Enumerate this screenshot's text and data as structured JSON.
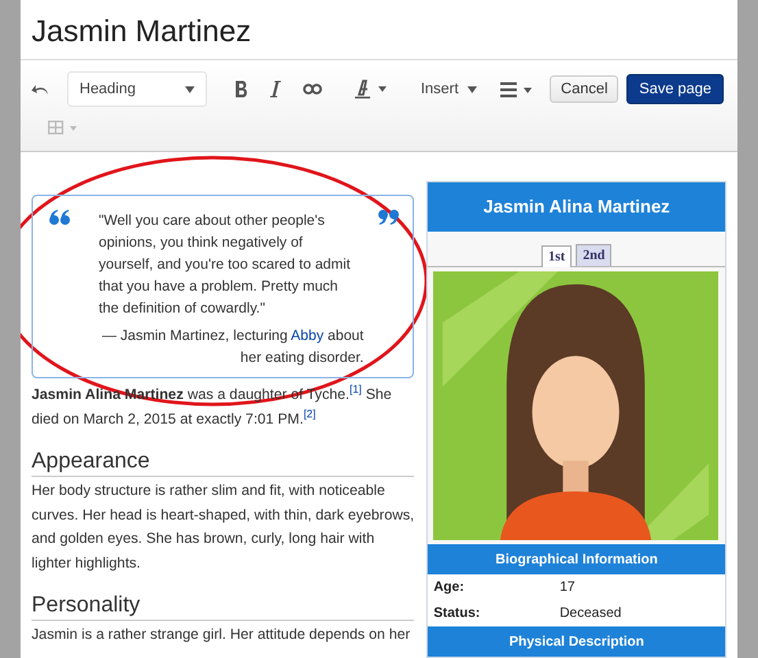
{
  "page": {
    "title": "Jasmin Martinez"
  },
  "toolbar": {
    "format_dropdown": "Heading",
    "insert_menu": "Insert",
    "cancel": "Cancel",
    "save": "Save page"
  },
  "quote": {
    "text": "\"Well you care about other people's opinions, you think negatively of yourself, and you're too scared to admit that you have a problem. Pretty much the definition of cowardly.\"",
    "attribution_start": "— Jasmin Martinez, lecturing",
    "link": "Abby",
    "attribution_end": "about her eating disorder."
  },
  "intro": "**Jasmin Alina Martinez** was a daughter of Tyche.$^{[1]}$ She died on March 2, 2015 at exactly 7:01 PM.$^{[2]}$",
  "sections": [
    {
      "heading": "Appearance",
      "text": "Her body structure is rather slim and fit, with noticeable curves. Her head is heart-shaped, with thin, dark eyebrows, and golden eyes. She has brown, curly, long hair with lighter highlights."
    },
    {
      "heading": "Personality",
      "text": "Jasmin is a rather strange girl. Her attitude depends on her"
    }
  ],
  "infobox": {
    "title": "Jasmin Alina Martinez",
    "tabs": [
      {
        "label": "1st",
        "selected": true
      },
      {
        "label": "2nd",
        "selected": false
      }
    ],
    "sections": [
      {
        "heading": "Biographical Information",
        "rows": [
          {
            "label": "Age:",
            "value": "17"
          },
          {
            "label": "Status:",
            "value": "Deceased"
          }
        ]
      },
      {
        "heading": "Physical Description"
      }
    ]
  },
  "annotation": {
    "kind": "ellipse"
  }
}
